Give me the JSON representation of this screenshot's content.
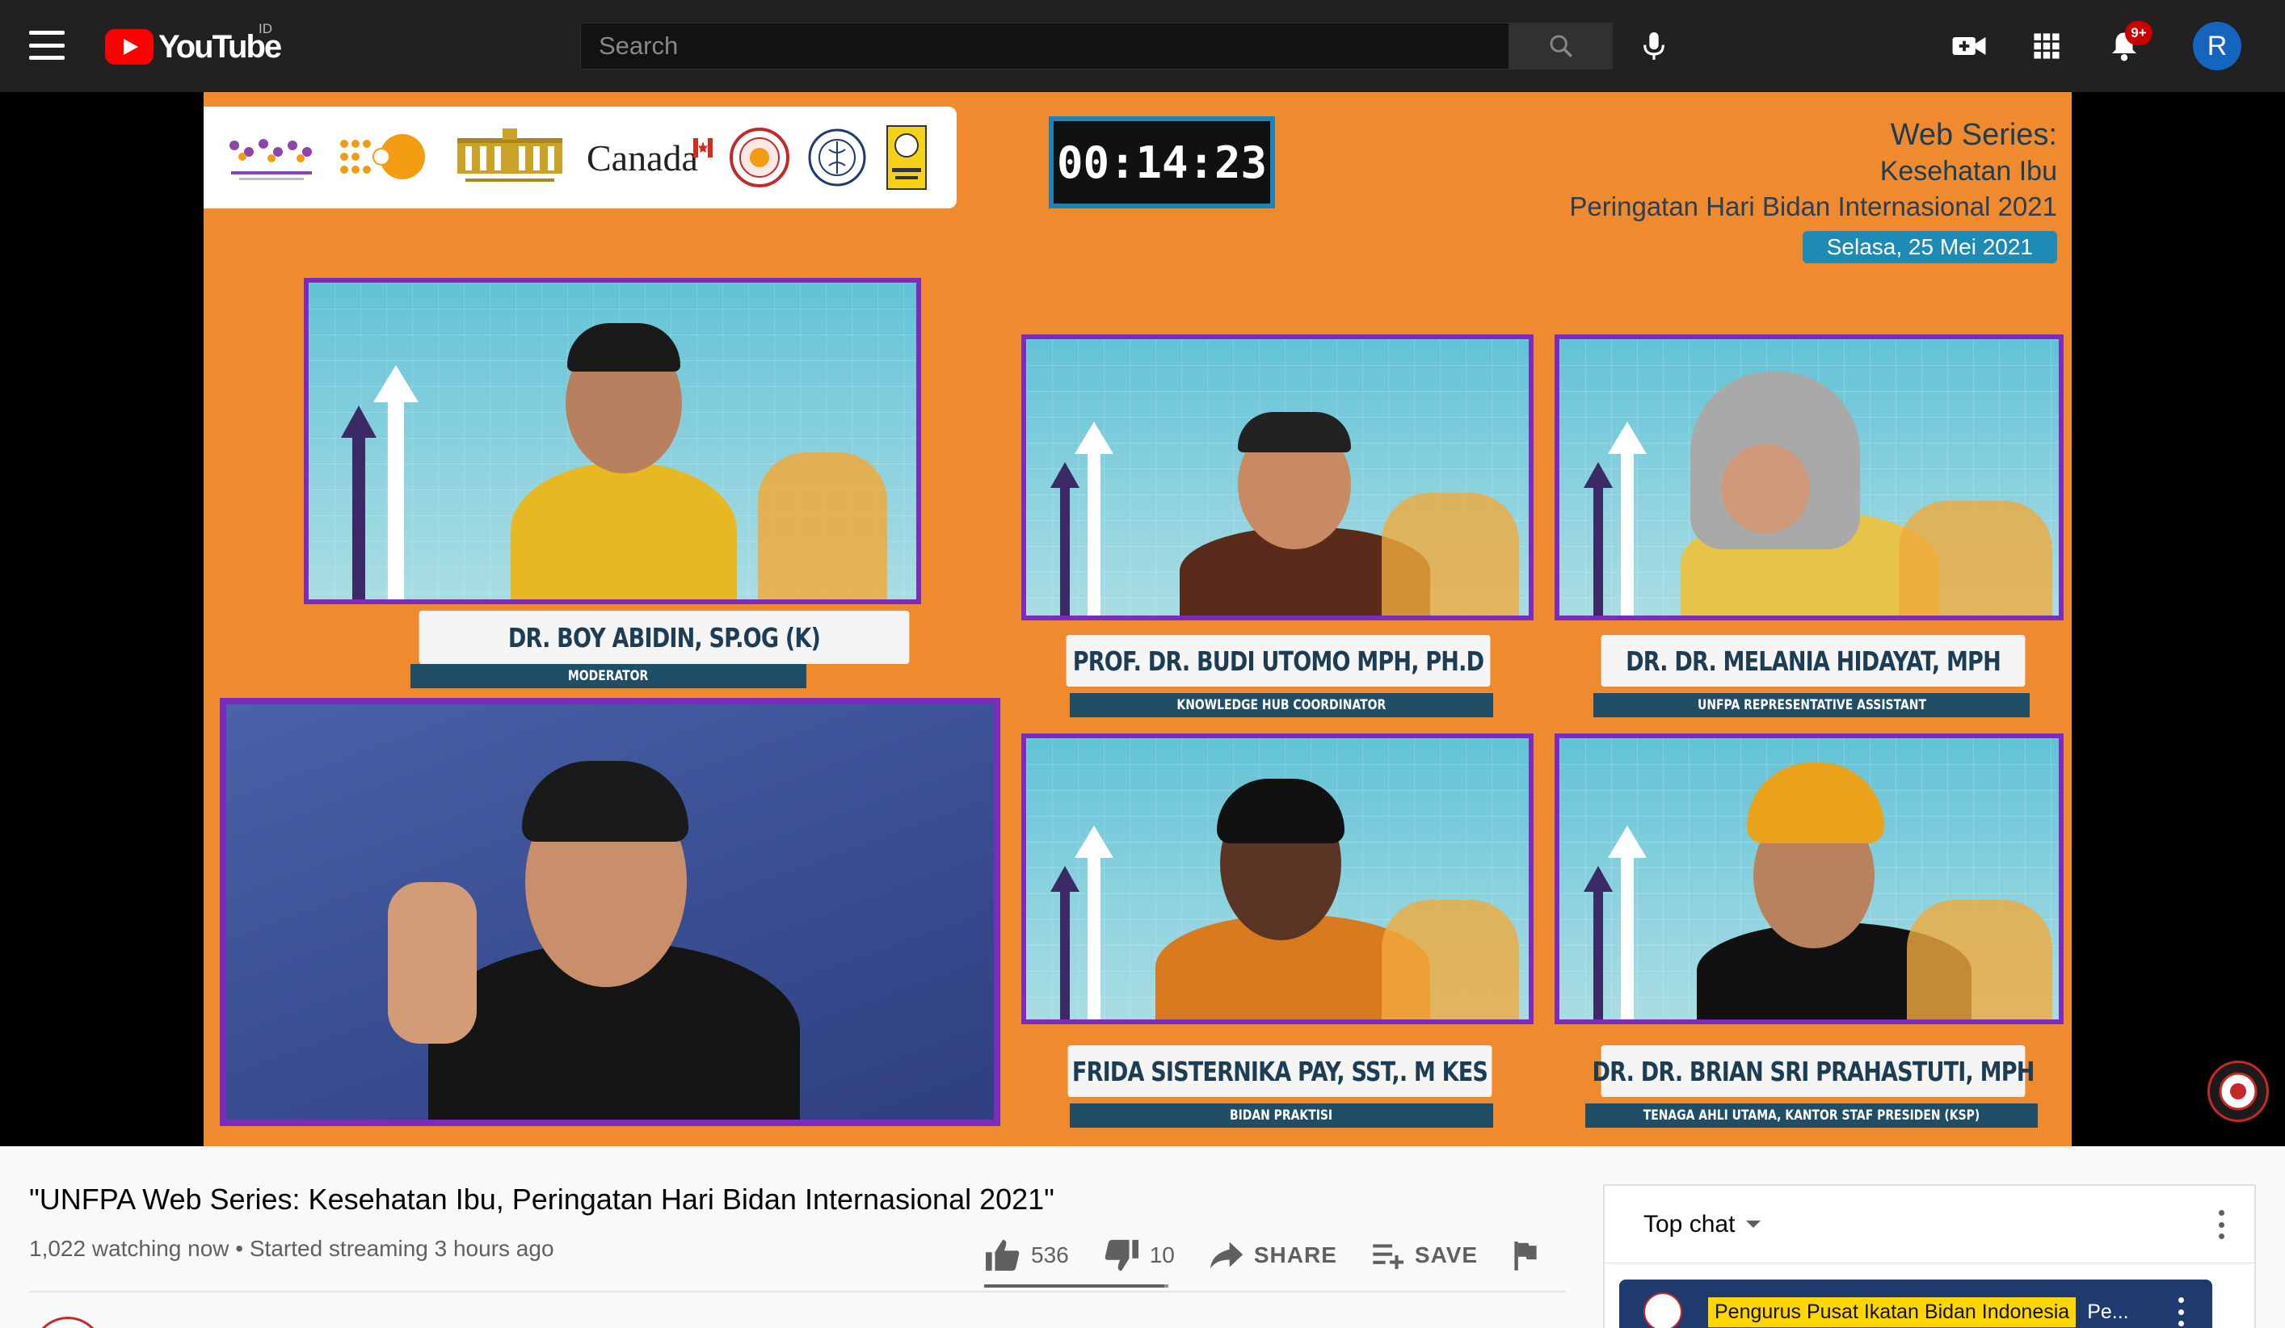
{
  "header": {
    "logo_text": "YouTube",
    "region": "ID",
    "search_placeholder": "Search",
    "notifications_badge": "9+",
    "avatar_initial": "R"
  },
  "stream": {
    "timer": "00:14:23",
    "canada_logo": "Canada",
    "series": {
      "line1": "Web Series:",
      "line2": "Kesehatan Ibu",
      "line3": "Peringatan Hari Bidan Internasional 2021",
      "date": "Selasa, 25 Mei 2021"
    },
    "speakers": [
      {
        "name": "DR. BOY ABIDIN, SP.OG (K)",
        "role": "MODERATOR"
      },
      {
        "name": "PROF. DR. BUDI UTOMO MPH, PH.D",
        "role": "KNOWLEDGE HUB COORDINATOR"
      },
      {
        "name": "DR. DR. MELANIA HIDAYAT, MPH",
        "role": "UNFPA REPRESENTATIVE ASSISTANT"
      },
      {
        "name": "FRIDA SISTERNIKA PAY, SST,. M KES",
        "role": "BIDAN PRAKTISI"
      },
      {
        "name": "DR. DR. BRIAN SRI PRAHASTUTI, MPH",
        "role": "TENAGA AHLI UTAMA, KANTOR STAF PRESIDEN (KSP)"
      }
    ]
  },
  "video": {
    "title": "\"UNFPA Web Series: Kesehatan Ibu, Peringatan Hari Bidan Internasional 2021\"",
    "meta": "1,022 watching now • Started streaming 3 hours ago",
    "likes": "536",
    "dislikes": "10",
    "like_ratio": 0.98,
    "share_label": "SHARE",
    "save_label": "SAVE"
  },
  "chat": {
    "mode": "Top chat",
    "pinned_author": "Pengurus Pusat Ikatan Bidan Indonesia",
    "pinned_message": "Pe..."
  },
  "colors": {
    "brand_red": "#ff0000",
    "stream_orange": "#f08a2e",
    "tile_border": "#7b2cbf",
    "badge_red": "#cc0000"
  }
}
